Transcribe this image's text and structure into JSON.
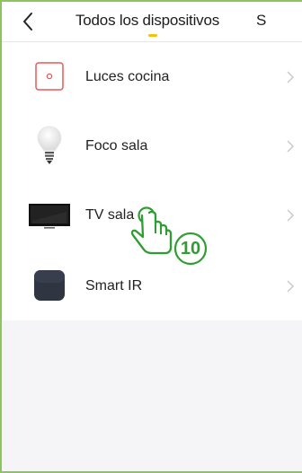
{
  "header": {
    "back_icon": "chevron-left-icon",
    "title": "Todos los dispositivos",
    "next_tab_label": "S",
    "accent_color": "#f2c20e"
  },
  "devices": [
    {
      "label": "Luces cocina",
      "icon": "switch-icon"
    },
    {
      "label": "Foco sala",
      "icon": "bulb-icon"
    },
    {
      "label": "TV sala",
      "icon": "tv-icon"
    },
    {
      "label": "Smart IR",
      "icon": "ir-remote-icon"
    }
  ],
  "annotation": {
    "step_number": "10",
    "icon": "tap-hand-icon",
    "color": "#2f9e32"
  },
  "frame_color": "#8cc55b"
}
